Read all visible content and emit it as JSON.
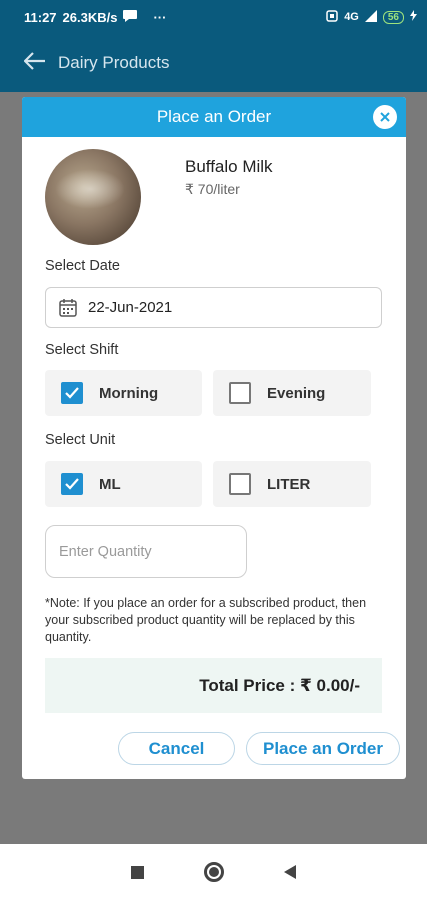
{
  "status_bar": {
    "time": "11:27",
    "speed": "26.3KB/s",
    "more": "···",
    "network": "4G",
    "battery": "56"
  },
  "app_bar": {
    "title": "Dairy Products"
  },
  "dialog": {
    "title": "Place an Order",
    "product": {
      "name": "Buffalo Milk",
      "price": "₹ 70/liter"
    },
    "date_label": "Select Date",
    "date_value": "22-Jun-2021",
    "shift_label": "Select Shift",
    "shifts": [
      {
        "label": "Morning",
        "checked": true
      },
      {
        "label": "Evening",
        "checked": false
      }
    ],
    "unit_label": "Select Unit",
    "units": [
      {
        "label": "ML",
        "checked": true
      },
      {
        "label": "LITER",
        "checked": false
      }
    ],
    "quantity_placeholder": "Enter Quantity",
    "note": "*Note: If you place an order for a subscribed product, then your subscribed product quantity will be replaced by this quantity.",
    "total_price": "Total Price : ₹ 0.00/-",
    "cancel_label": "Cancel",
    "order_label": "Place an Order"
  },
  "colors": {
    "header": "#1fa3dd",
    "accent": "#1f8fd0",
    "app_bar": "#0a5a7d"
  }
}
